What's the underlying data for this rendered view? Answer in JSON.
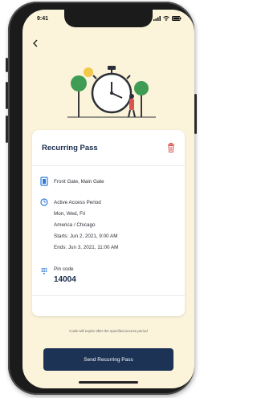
{
  "status_bar": {
    "time": "9:41"
  },
  "card": {
    "title": "Recurring Pass",
    "location": "Front Gate, Main Gate",
    "access_period_label": "Active Access Period",
    "days": "Mon, Wed, Fri",
    "timezone": "America / Chicago",
    "starts": "Starts: Jun 2, 2021, 9:00 AM",
    "ends": "Ends: Jun 3, 2021, 11:00 AM",
    "pin_label": "Pin code",
    "pin_value": "14004"
  },
  "footnote": "Code will expire after the specified access period",
  "send_button": "Send Recurring Pass",
  "colors": {
    "brand_navy": "#1c3355",
    "accent_blue": "#2f7ad8",
    "danger": "#d9534f",
    "screen_bg": "#fbf3da"
  }
}
